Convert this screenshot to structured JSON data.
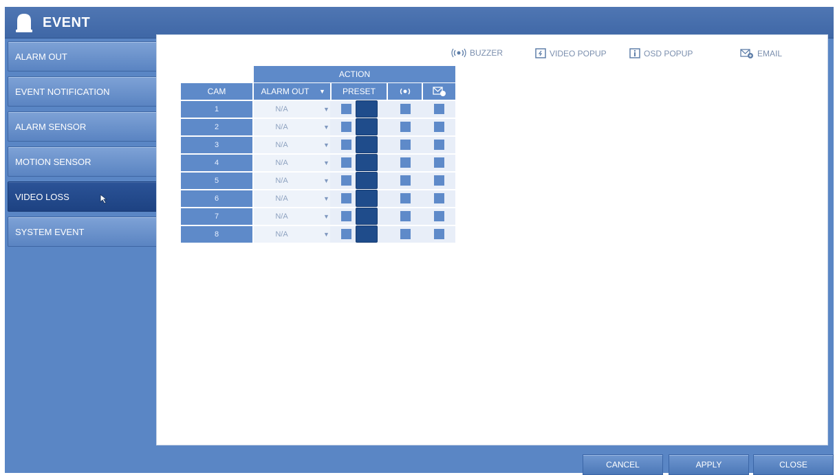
{
  "window": {
    "title": "EVENT"
  },
  "sidebar": {
    "items": [
      {
        "label": "ALARM OUT",
        "active": false
      },
      {
        "label": "EVENT NOTIFICATION",
        "active": false
      },
      {
        "label": "ALARM SENSOR",
        "active": false
      },
      {
        "label": "MOTION SENSOR",
        "active": false
      },
      {
        "label": "VIDEO LOSS",
        "active": true
      },
      {
        "label": "SYSTEM EVENT",
        "active": false
      }
    ]
  },
  "legend": {
    "buzzer": "BUZZER",
    "video_popup": "VIDEO POPUP",
    "osd_popup": "OSD POPUP",
    "email": "EMAIL"
  },
  "table": {
    "action_header": "ACTION",
    "cam_header": "CAM",
    "alarm_out_header": "ALARM OUT",
    "preset_header": "PRESET",
    "rows": [
      {
        "cam": "1",
        "alarm_out": "N/A"
      },
      {
        "cam": "2",
        "alarm_out": "N/A"
      },
      {
        "cam": "3",
        "alarm_out": "N/A"
      },
      {
        "cam": "4",
        "alarm_out": "N/A"
      },
      {
        "cam": "5",
        "alarm_out": "N/A"
      },
      {
        "cam": "6",
        "alarm_out": "N/A"
      },
      {
        "cam": "7",
        "alarm_out": "N/A"
      },
      {
        "cam": "8",
        "alarm_out": "N/A"
      }
    ]
  },
  "footer": {
    "cancel_label": "CANCEL",
    "apply_label": "APPLY",
    "close_label": "CLOSE"
  },
  "colors": {
    "frame": "#5a86c5",
    "header": "#5e8ac9",
    "active_item": "#1d4282",
    "legend_text": "#7b8fae"
  }
}
